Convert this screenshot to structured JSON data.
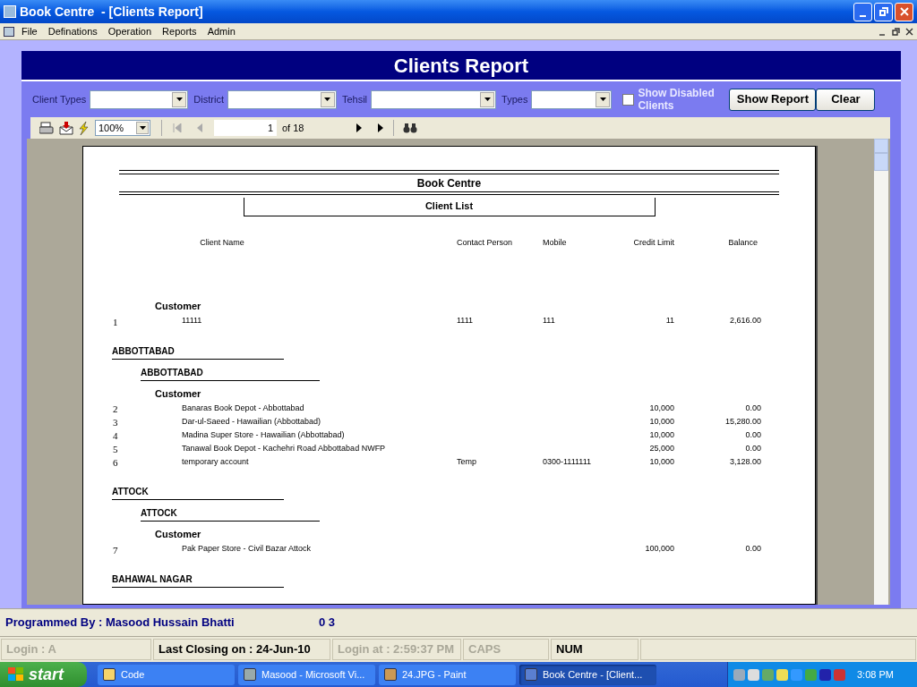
{
  "window": {
    "title": "Book Centre  - [Clients Report]"
  },
  "menu": [
    "File",
    "Definations",
    "Operation",
    "Reports",
    "Admin"
  ],
  "form_title": "Clients Report",
  "filters": [
    {
      "label": "Client Types"
    },
    {
      "label": "District"
    },
    {
      "label": "Tehsil"
    },
    {
      "label": "Types"
    }
  ],
  "show_disabled": {
    "label": "Show Disabled Clients",
    "checked": false
  },
  "buttons": [
    "Show Report",
    "Clear"
  ],
  "viewer_toolbar": {
    "zoom": "100%",
    "page": "1",
    "page_count": "of 18"
  },
  "report": {
    "company": "Book Centre",
    "title": "Client List",
    "columns": [
      "Client Name",
      "Contact Person",
      "Mobile",
      "Credit Limit",
      "Balance"
    ],
    "sections": [
      {
        "client_type": "Customer",
        "rows": [
          {
            "no": "1",
            "name": "11111",
            "contact": "1111",
            "mobile": "111",
            "credit": "11",
            "balance": "2,616.00"
          }
        ]
      },
      {
        "district": "ABBOTTABAD",
        "tehsil": "ABBOTTABAD",
        "client_type": "Customer",
        "rows": [
          {
            "no": "2",
            "name": "Banaras Book Depot - Abbottabad",
            "credit": "10,000",
            "balance": "0.00"
          },
          {
            "no": "3",
            "name": "Dar-ul-Saeed - Hawailian (Abbottabad)",
            "credit": "10,000",
            "balance": "15,280.00"
          },
          {
            "no": "4",
            "name": "Madina Super Store - Hawailian (Abbottabad)",
            "credit": "10,000",
            "balance": "0.00"
          },
          {
            "no": "5",
            "name": "Tanawal Book Depot - Kachehri Road Abbottabad NWFP",
            "credit": "25,000",
            "balance": "0.00"
          },
          {
            "no": "6",
            "name": "temporary account",
            "contact": "Temp",
            "mobile": "0300-1111111",
            "credit": "10,000",
            "balance": "3,128.00"
          }
        ]
      },
      {
        "district": "ATTOCK",
        "tehsil": "ATTOCK",
        "client_type": "Customer",
        "rows": [
          {
            "no": "7",
            "name": "Pak Paper Store - Civil Bazar Attock",
            "credit": "100,000",
            "balance": "0.00"
          }
        ]
      },
      {
        "district": "BAHAWAL NAGAR"
      }
    ]
  },
  "status_bar": {
    "credit": "Programmed By : Masood Hussain Bhatti",
    "code": "0 3",
    "panels": [
      {
        "text": "Login :  A",
        "active": false
      },
      {
        "text": "Last Closing on : 24-Jun-10",
        "active": true
      },
      {
        "text": "Login at : 2:59:37 PM",
        "active": false
      },
      {
        "text": "CAPS",
        "active": false
      },
      {
        "text": "NUM",
        "active": true
      }
    ]
  },
  "taskbar": {
    "start": "start",
    "tasks": [
      {
        "label": "Code",
        "selected": false
      },
      {
        "label": "Masood - Microsoft Vi...",
        "selected": false
      },
      {
        "label": "24.JPG - Paint",
        "selected": false
      },
      {
        "label": "Book Centre  - [Client...",
        "selected": true
      }
    ],
    "clock": "3:08 PM"
  }
}
